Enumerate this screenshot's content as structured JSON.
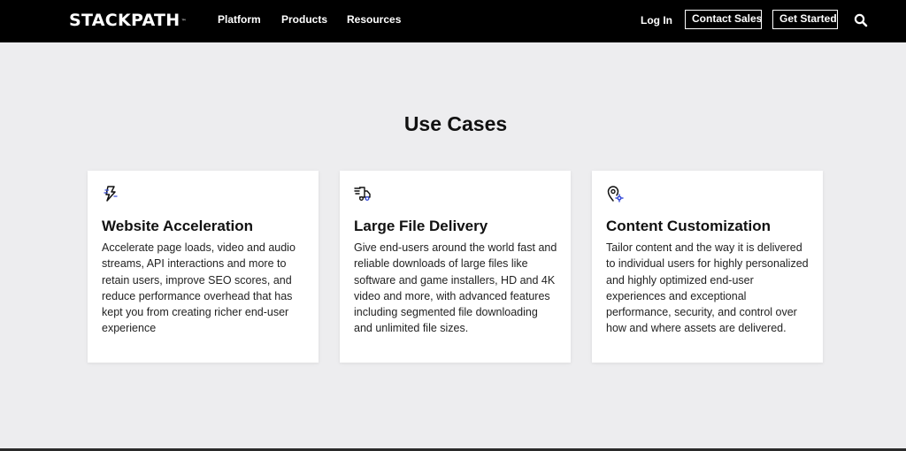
{
  "nav": {
    "logo": "STACKPATH",
    "logo_tm": "™",
    "links": [
      "Platform",
      "Products",
      "Resources"
    ],
    "login": "Log In",
    "contact_sales": "Contact Sales",
    "get_started": "Get Started",
    "search_icon": "search-icon"
  },
  "main": {
    "title": "Use Cases",
    "cards": [
      {
        "icon": "lightning-bolt-icon",
        "title": "Website Acceleration",
        "description": "Accelerate page loads, video and audio streams, API interactions and more to retain users, improve SEO scores, and reduce performance overhead that has kept you from creating richer end-user experience"
      },
      {
        "icon": "delivery-truck-icon",
        "title": "Large File Delivery",
        "description": "Give end-users around the world fast and reliable downloads of large files like software and game installers, HD and 4K video and more, with advanced features including segmented file downloading and unlimited file sizes."
      },
      {
        "icon": "location-gear-icon",
        "title": "Content Customization",
        "description": "Tailor content and the way it is delivered to individual users for highly personalized and highly optimized end-user experiences and exceptional performance, security, and control over how and where assets are delivered."
      }
    ]
  },
  "colors": {
    "navbar_bg": "#000000",
    "page_bg": "#ededef",
    "card_bg": "#ffffff",
    "icon_accent": "#3b4fd8"
  }
}
